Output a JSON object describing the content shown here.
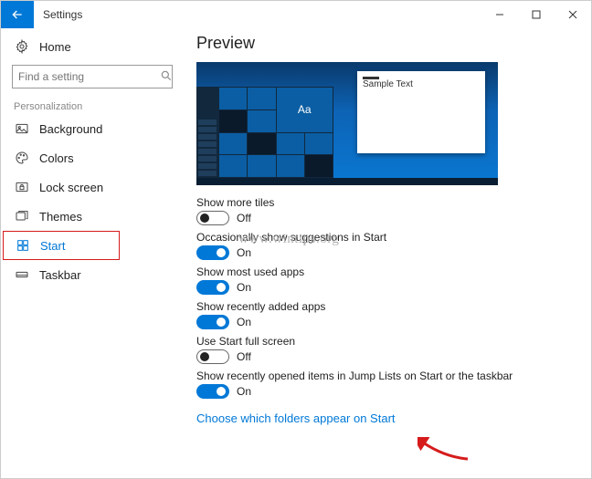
{
  "window": {
    "title": "Settings"
  },
  "sidebar": {
    "home": "Home",
    "searchPlaceholder": "Find a setting",
    "section": "Personalization",
    "items": [
      {
        "label": "Background"
      },
      {
        "label": "Colors"
      },
      {
        "label": "Lock screen"
      },
      {
        "label": "Themes"
      },
      {
        "label": "Start"
      },
      {
        "label": "Taskbar"
      }
    ]
  },
  "main": {
    "heading": "Preview",
    "previewTile": "Aa",
    "previewSample": "Sample Text",
    "settings": [
      {
        "label": "Show more tiles",
        "state": "Off",
        "on": false
      },
      {
        "label": "Occasionally show suggestions in Start",
        "state": "On",
        "on": true
      },
      {
        "label": "Show most used apps",
        "state": "On",
        "on": true
      },
      {
        "label": "Show recently added apps",
        "state": "On",
        "on": true
      },
      {
        "label": "Use Start full screen",
        "state": "Off",
        "on": false
      },
      {
        "label": "Show recently opened items in Jump Lists on Start or the taskbar",
        "state": "On",
        "on": true
      }
    ],
    "link": "Choose which folders appear on Start"
  },
  "watermark": "www.wintips.org"
}
